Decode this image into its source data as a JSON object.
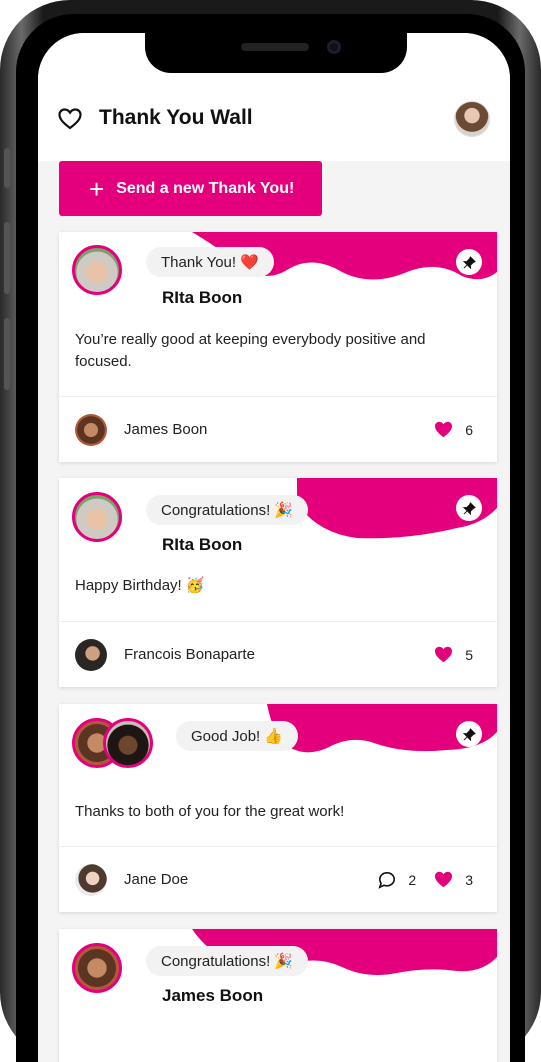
{
  "app": {
    "title": "Thank You Wall"
  },
  "actions": {
    "send_label": "Send a new Thank You!"
  },
  "colors": {
    "accent": "#e4007c"
  },
  "cards": [
    {
      "badge": "Thank You! ❤️",
      "recipient": "RIta Boon",
      "message": "You’re really good at keeping everybody positive and focused.",
      "sender": "James Boon",
      "likes": "6"
    },
    {
      "badge": "Congratulations! 🎉",
      "recipient": "RIta Boon",
      "message": "Happy Birthday! 🥳",
      "sender": "Francois Bonaparte",
      "likes": "5"
    },
    {
      "badge": "Good Job! 👍",
      "recipient": "",
      "message": "Thanks to both of you for the great work!",
      "sender": "Jane Doe",
      "comments": "2",
      "likes": "3"
    },
    {
      "badge": "Congratulations! 🎉",
      "recipient": "James Boon"
    }
  ],
  "icons": {
    "pin": "pin-icon",
    "heart": "heart-icon",
    "comment": "comment-icon",
    "plus": "plus-icon",
    "wall": "heart-outline-icon"
  }
}
